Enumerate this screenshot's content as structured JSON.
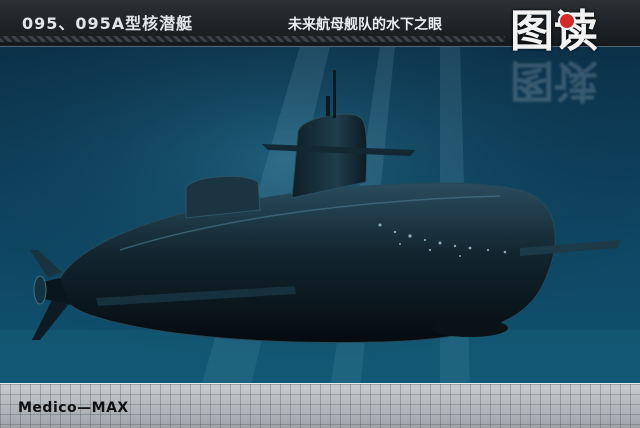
{
  "header": {
    "title_left": "095、095A型核潜艇",
    "title_right": "未来航母舰队的水下之眼"
  },
  "logo": {
    "text": "图读"
  },
  "footer": {
    "brand": "Medico—MAX"
  },
  "colors": {
    "water_top": "#0b2c43",
    "water_bottom": "#0f5773",
    "hull": "#0b1820"
  }
}
